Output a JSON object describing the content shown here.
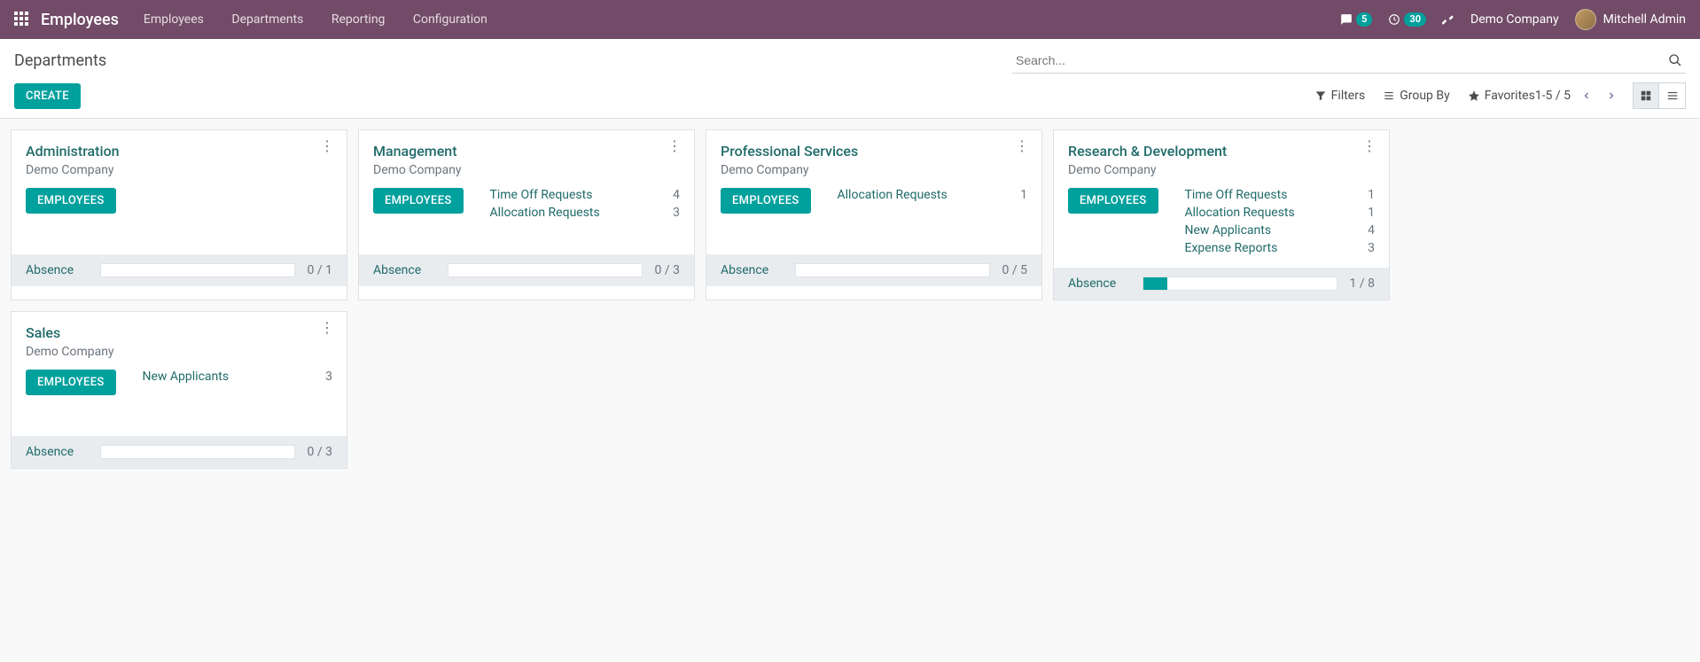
{
  "header": {
    "brand": "Employees",
    "menu": [
      "Employees",
      "Departments",
      "Reporting",
      "Configuration"
    ],
    "messages_count": "5",
    "activities_count": "30",
    "company": "Demo Company",
    "user": "Mitchell Admin"
  },
  "cp": {
    "breadcrumb": "Departments",
    "create": "CREATE",
    "search_placeholder": "Search...",
    "filters": "Filters",
    "groupby": "Group By",
    "favorites": "Favorites",
    "pager": "1-5 / 5"
  },
  "colors": {
    "primary": "#00a09d",
    "nav": "#714b67",
    "link": "#206b6a"
  },
  "cards": [
    {
      "name": "Administration",
      "company": "Demo Company",
      "btn": "EMPLOYEES",
      "links": [],
      "absence_label": "Absence",
      "absence_ratio": "0 / 1",
      "absence_pct": 0
    },
    {
      "name": "Management",
      "company": "Demo Company",
      "btn": "EMPLOYEES",
      "links": [
        {
          "label": "Time Off Requests",
          "count": "4"
        },
        {
          "label": "Allocation Requests",
          "count": "3"
        }
      ],
      "absence_label": "Absence",
      "absence_ratio": "0 / 3",
      "absence_pct": 0
    },
    {
      "name": "Professional Services",
      "company": "Demo Company",
      "btn": "EMPLOYEES",
      "links": [
        {
          "label": "Allocation Requests",
          "count": "1"
        }
      ],
      "absence_label": "Absence",
      "absence_ratio": "0 / 5",
      "absence_pct": 0
    },
    {
      "name": "Research & Development",
      "company": "Demo Company",
      "btn": "EMPLOYEES",
      "links": [
        {
          "label": "Time Off Requests",
          "count": "1"
        },
        {
          "label": "Allocation Requests",
          "count": "1"
        },
        {
          "label": "New Applicants",
          "count": "4"
        },
        {
          "label": "Expense Reports",
          "count": "3"
        }
      ],
      "absence_label": "Absence",
      "absence_ratio": "1 / 8",
      "absence_pct": 12.5
    },
    {
      "name": "Sales",
      "company": "Demo Company",
      "btn": "EMPLOYEES",
      "links": [
        {
          "label": "New Applicants",
          "count": "3"
        }
      ],
      "absence_label": "Absence",
      "absence_ratio": "0 / 3",
      "absence_pct": 0
    }
  ]
}
